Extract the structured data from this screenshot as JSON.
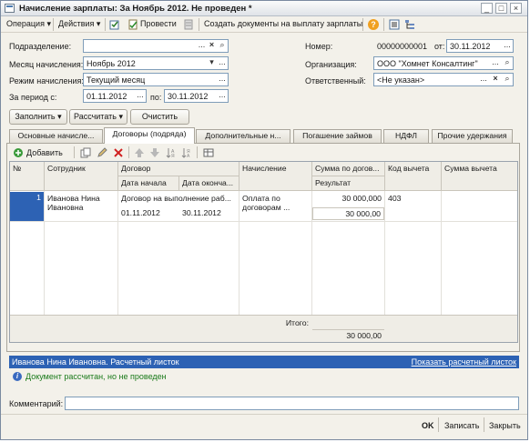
{
  "window": {
    "title": "Начисление зарплаты: За Ноябрь 2012. Не проведен *",
    "min": "_",
    "max": "□",
    "close": "×"
  },
  "toolbar": {
    "operation": "Операция ▾",
    "actions": "Действия ▾",
    "post": "Провести",
    "create_docs": "Создать документы на выплату зарплаты",
    "help": "?"
  },
  "form": {
    "podrazdelenie_label": "Подразделение:",
    "podrazdelenie_value": "",
    "month_label": "Месяц начисления:",
    "month_value": "Ноябрь 2012",
    "mode_label": "Режим начисления:",
    "mode_value": "Текущий месяц",
    "period_label": "За период с:",
    "period_from": "01.11.2012",
    "period_to_label": "по:",
    "period_to": "30.11.2012",
    "number_label": "Номер:",
    "number_value": "00000000001",
    "date_label": "от:",
    "date_value": "30.11.2012",
    "org_label": "Организация:",
    "org_value": "ООО \"Хомнет Консалтинг\"",
    "resp_label": "Ответственный:",
    "resp_value": "<Не указан>"
  },
  "buttons": {
    "fill": "Заполнить",
    "calc": "Рассчитать",
    "clear": "Очистить",
    "dots": "...",
    "x": "×",
    "search": "⌕",
    "drop": "▾"
  },
  "tabs": [
    {
      "label": "Основные начисле..."
    },
    {
      "label": "Договоры (подряда)"
    },
    {
      "label": "Дополнительные н..."
    },
    {
      "label": "Погашение займов"
    },
    {
      "label": "НДФЛ"
    },
    {
      "label": "Прочие удержания"
    }
  ],
  "grid_toolbar": {
    "add": "Добавить"
  },
  "grid": {
    "headers": {
      "num": "№",
      "employee": "Сотрудник",
      "contract": "Договор",
      "start": "Дата начала",
      "end": "Дата оконча...",
      "accrual": "Начисление",
      "sum": "Сумма по догов...",
      "result": "Результат",
      "code": "Код вычета",
      "deduct": "Сумма вычета"
    },
    "rows": [
      {
        "num": "1",
        "employee": "Иванова Нина Ивановна",
        "contract": "Договор на выполнение раб...",
        "start": "01.11.2012",
        "end": "30.11.2012",
        "accrual": "Оплата по договорам ...",
        "sum": "30 000,000",
        "result": "30 000,00",
        "code": "403",
        "deduct": ""
      }
    ],
    "footer_label": "Итого:",
    "footer_value": "30 000,00"
  },
  "status": {
    "payslip_title": "Иванова Нина Ивановна. Расчетный листок",
    "show_payslip": "Показать расчетный листок",
    "message": "Документ рассчитан, но не проведен"
  },
  "comment": {
    "label": "Комментарий:",
    "value": ""
  },
  "bottom": {
    "ok": "OK",
    "save": "Записать",
    "close": "Закрыть"
  },
  "colors": {
    "accent": "#2d62b4",
    "selected_cell": "#2d62b4",
    "message": "#1a7a1a"
  }
}
